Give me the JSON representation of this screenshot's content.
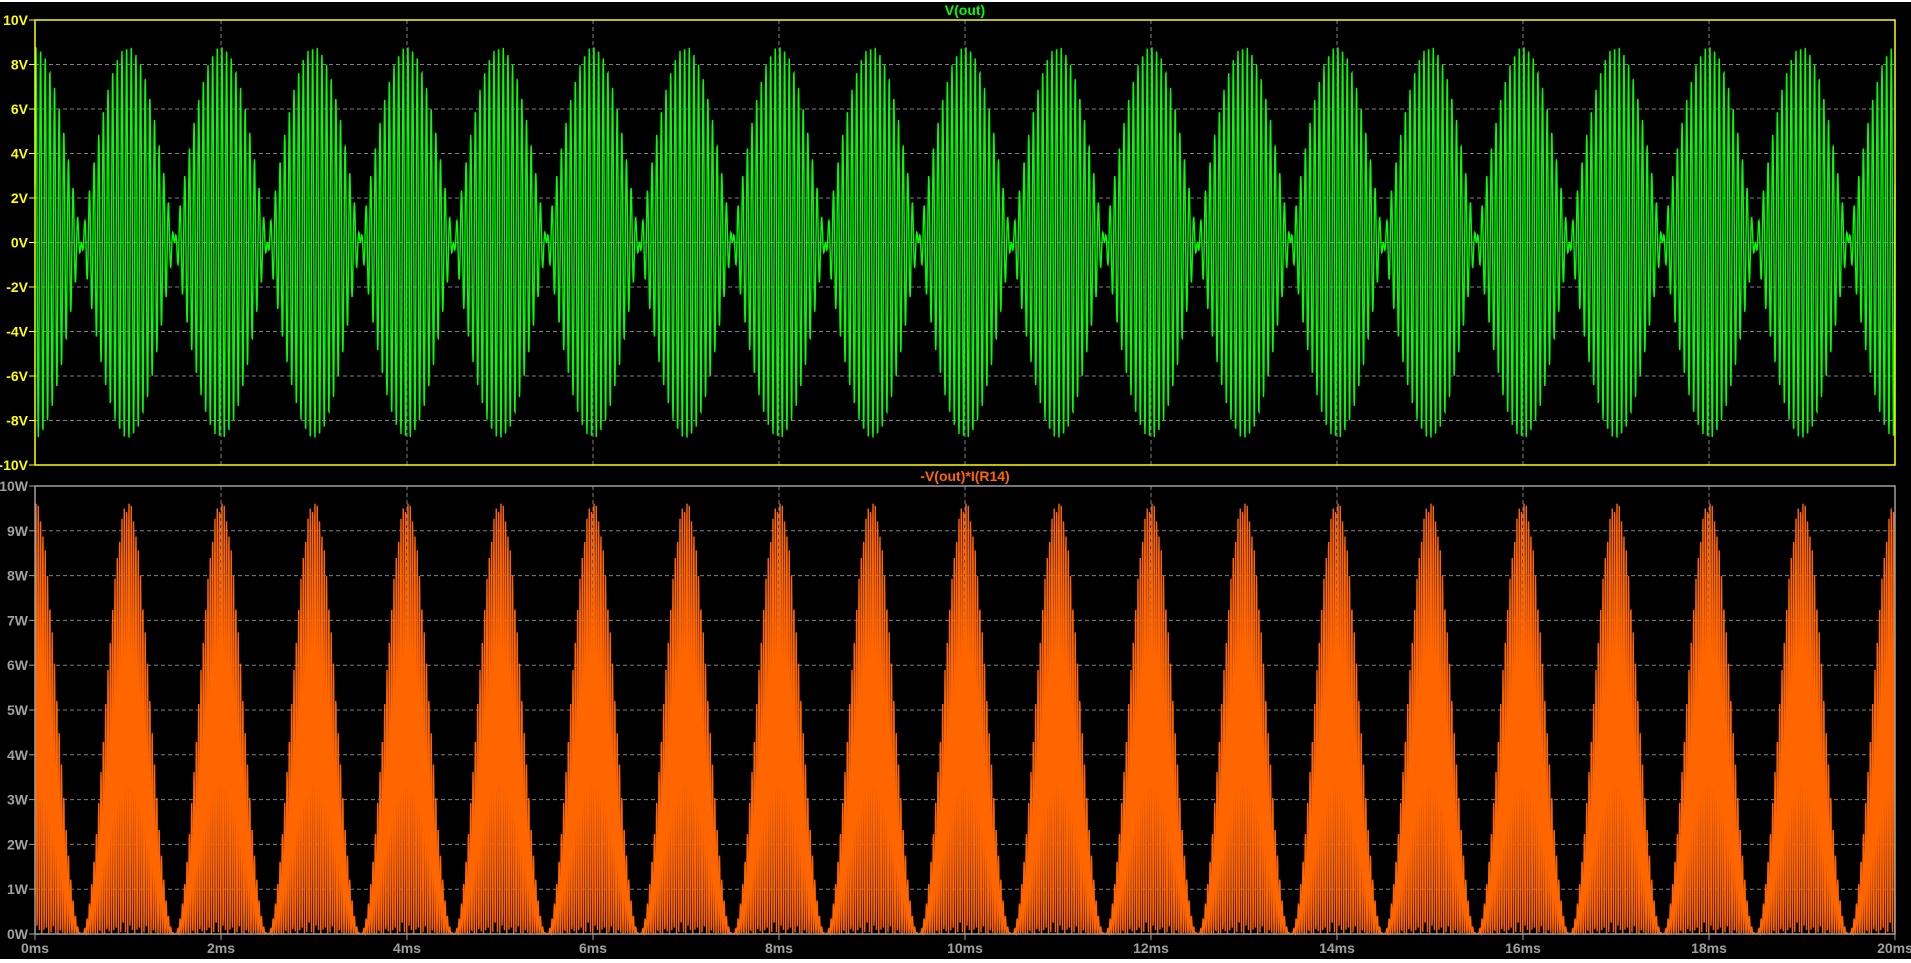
{
  "chart_data": [
    {
      "type": "line",
      "title": "V(out)",
      "xlabel": "",
      "ylabel": "",
      "xlim": [
        0,
        20
      ],
      "x_unit": "ms",
      "ylim": [
        -10,
        10
      ],
      "x_ticks": [
        "0ms",
        "2ms",
        "4ms",
        "6ms",
        "8ms",
        "10ms",
        "12ms",
        "14ms",
        "16ms",
        "18ms",
        "20ms"
      ],
      "x_tick_values": [
        0,
        2,
        4,
        6,
        8,
        10,
        12,
        14,
        16,
        18,
        20
      ],
      "y_ticks": [
        "10V",
        "8V",
        "6V",
        "4V",
        "2V",
        "0V",
        "-2V",
        "-4V",
        "-6V",
        "-8V",
        "-10V"
      ],
      "y_tick_values": [
        10,
        8,
        6,
        4,
        2,
        0,
        -2,
        -4,
        -6,
        -8,
        -10
      ],
      "grid": true,
      "series": [
        {
          "name": "V(out)",
          "color": "#00ff00",
          "description_values": {
            "envelope_peak": 8.8,
            "envelope_period_ms": 2,
            "envelope_lobes": 20,
            "carrier_khz": 20
          }
        }
      ]
    },
    {
      "type": "line",
      "title": "-V(out)*I(R14)",
      "xlabel": "",
      "ylabel": "",
      "xlim": [
        0,
        20
      ],
      "x_unit": "ms",
      "ylim": [
        0,
        10
      ],
      "x_ticks": [
        "0ms",
        "2ms",
        "4ms",
        "6ms",
        "8ms",
        "10ms",
        "12ms",
        "14ms",
        "16ms",
        "18ms",
        "20ms"
      ],
      "x_tick_values": [
        0,
        2,
        4,
        6,
        8,
        10,
        12,
        14,
        16,
        18,
        20
      ],
      "y_ticks": [
        "10W",
        "9W",
        "8W",
        "7W",
        "6W",
        "5W",
        "4W",
        "3W",
        "2W",
        "1W",
        "0W"
      ],
      "y_tick_values": [
        10,
        9,
        8,
        7,
        6,
        5,
        4,
        3,
        2,
        1,
        0
      ],
      "grid": true,
      "series": [
        {
          "name": "-V(out)*I(R14)",
          "color": "#ff6600",
          "description_values": {
            "peak": 9.7,
            "lobes": 20
          }
        }
      ]
    }
  ],
  "colors": {
    "top_axis": "#ffff00",
    "bottom_axis": "#a0a0a0",
    "grid": "#808080",
    "background": "#000000"
  }
}
